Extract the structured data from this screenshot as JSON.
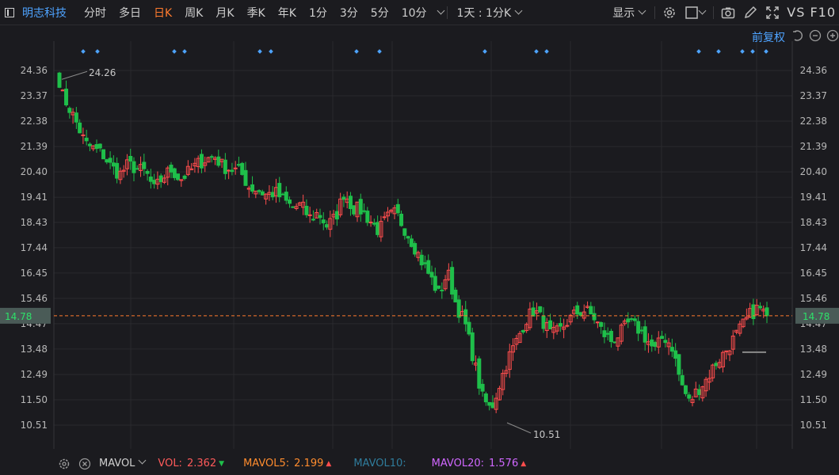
{
  "toolbar": {
    "stock_name": "明志科技",
    "tabs": [
      "分时",
      "多日",
      "日K",
      "周K",
      "月K",
      "季K",
      "年K",
      "1分",
      "3分",
      "5分",
      "10分"
    ],
    "active_tab_index": 2,
    "period_select": "1天 : 1分K",
    "display_label": "显示",
    "vs_f10": "VS F10"
  },
  "chart": {
    "adjust_label": "前复权",
    "price_ticks": [
      "24.36",
      "23.37",
      "22.38",
      "21.39",
      "20.40",
      "19.41",
      "18.43",
      "17.44",
      "16.45",
      "15.46",
      "14.47",
      "13.48",
      "12.49",
      "11.50",
      "10.51"
    ],
    "current_price": "14.78",
    "high_label": "24.26",
    "low_label": "10.51",
    "colors": {
      "up": "#ff4d4d",
      "down": "#1fbf4a",
      "accent": "#ff7b2e",
      "blue": "#4ea3ff",
      "grid": "#2a2a2e",
      "current_badge": "#4a5b57"
    }
  },
  "chart_data": {
    "type": "candlestick",
    "ylim": [
      10.0,
      25.0
    ],
    "y_ticks": [
      24.36,
      23.37,
      22.38,
      21.39,
      20.4,
      19.41,
      18.43,
      17.44,
      16.45,
      15.46,
      14.47,
      13.48,
      12.49,
      11.5,
      10.51
    ],
    "current_price": 14.78,
    "max_label": 24.26,
    "min_label": 10.51,
    "anchor_closes": [
      23.6,
      23.0,
      22.3,
      21.5,
      21.3,
      21.1,
      20.6,
      20.3,
      20.7,
      20.5,
      20.4,
      19.7,
      20.2,
      20.5,
      20.1,
      20.4,
      20.7,
      20.9,
      21.0,
      20.6,
      20.5,
      20.4,
      19.8,
      19.7,
      19.5,
      19.6,
      19.3,
      19.0,
      19.1,
      18.6,
      18.8,
      18.3,
      18.6,
      19.6,
      19.0,
      18.9,
      18.5,
      18.1,
      18.6,
      18.8,
      18.2,
      17.6,
      16.9,
      16.3,
      15.6,
      16.5,
      15.2,
      14.5,
      13.1,
      11.6,
      11.1,
      12.1,
      13.1,
      13.8,
      14.6,
      15.0,
      14.6,
      14.0,
      14.2,
      14.6,
      14.9,
      15.0,
      14.7,
      14.1,
      13.8,
      14.1,
      14.5,
      14.3,
      13.9,
      13.4,
      14.0,
      13.6,
      12.2,
      11.4,
      11.9,
      12.3,
      12.9,
      13.3,
      13.8,
      14.3,
      14.8,
      15.1,
      14.8
    ],
    "event_markers": [
      105,
      123,
      220,
      233,
      328,
      342,
      450,
      479,
      612,
      677,
      690,
      882,
      907,
      937,
      950,
      967
    ]
  },
  "bottom": {
    "mavol_label": "MAVOL",
    "vol_label": "VOL:",
    "vol_value": "2.362",
    "ma5_label": "MAVOL5:",
    "ma5_value": "2.199",
    "ma10_label": "MAVOL10:",
    "ma20_label": "MAVOL20:",
    "ma20_value": "1.576",
    "colors": {
      "vol": "#ff5a5a",
      "ma5": "#ff8c2e",
      "ma10": "#2f7c9c",
      "ma20": "#d067ff"
    }
  }
}
